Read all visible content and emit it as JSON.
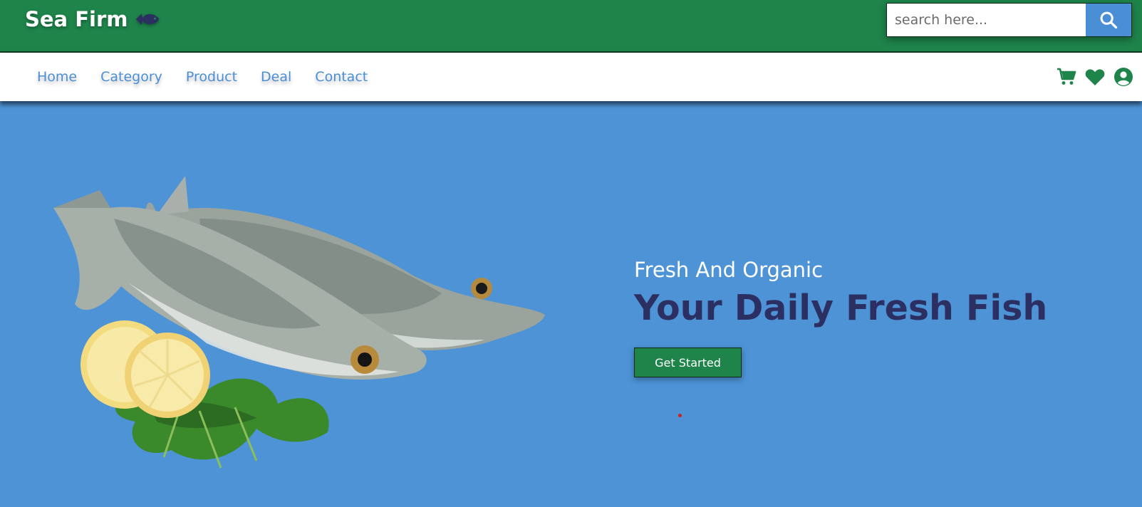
{
  "brand": {
    "name": "Sea Firm",
    "icon": "fish-icon"
  },
  "search": {
    "placeholder": "search here...",
    "value": "",
    "icon": "search-icon"
  },
  "nav": {
    "links": [
      "Home",
      "Category",
      "Product",
      "Deal",
      "Contact"
    ],
    "icons": [
      "cart-icon",
      "heart-icon",
      "user-icon"
    ]
  },
  "hero": {
    "subtitle": "Fresh And Organic",
    "title": "Your Daily Fresh Fish",
    "button": "Get Started",
    "image": "fish-image"
  },
  "colors": {
    "header_green": "#1e844a",
    "accent_blue": "#4d93d6",
    "title_navy": "#2b2f62",
    "link_blue": "#4a8fd6"
  }
}
